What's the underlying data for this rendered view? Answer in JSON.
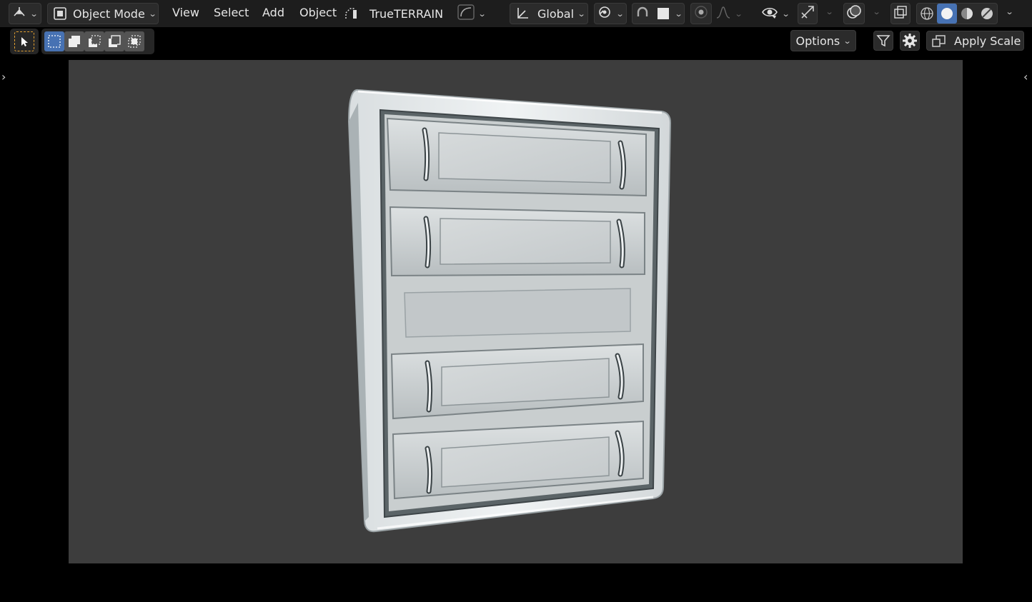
{
  "header": {
    "editor_type_icon": "editor-type-icon",
    "mode": {
      "label": "Object Mode",
      "icon": "object-mode-icon"
    },
    "menus": [
      "View",
      "Select",
      "Add",
      "Object"
    ],
    "addon": {
      "label": "TrueTERRAIN",
      "icon": "trueterrain-icon"
    },
    "transform_orientation": {
      "label": "Global",
      "icon": "orientation-icon"
    },
    "pivot_icon": "pivot-point-icon",
    "snap_icon": "snap-icon",
    "snap_target_icon": "snap-target-icon",
    "proportional_icon": "proportional-editing-icon",
    "falloff_icon": "falloff-curve-icon",
    "visibility_icon": "object-visibility-icon",
    "gizmo_icon": "gizmo-icon",
    "overlay_icon": "overlay-icon",
    "xray_icon": "xray-icon",
    "shading_modes": [
      "wireframe",
      "solid",
      "material-preview",
      "rendered"
    ],
    "active_shading": "solid"
  },
  "toolbar": {
    "select_tool_icon": "select-box-cursor-icon",
    "selection_modes": [
      "set-new",
      "extend",
      "subtract",
      "invert",
      "intersect"
    ],
    "options_label": "Options",
    "filter_icon": "filter-icon",
    "settings_icon": "gear-icon",
    "apply_scale_label": "Apply Scale",
    "apply_scale_icon": "apply-scale-icon"
  },
  "viewport": {
    "object": "cabinet-with-drawers",
    "drawer_count": 4
  },
  "colors": {
    "header_bg": "#1d1d1d",
    "viewport_bg": "#3d3d3d",
    "accent": "#4772b3",
    "button_bg": "#2b2b2b"
  }
}
